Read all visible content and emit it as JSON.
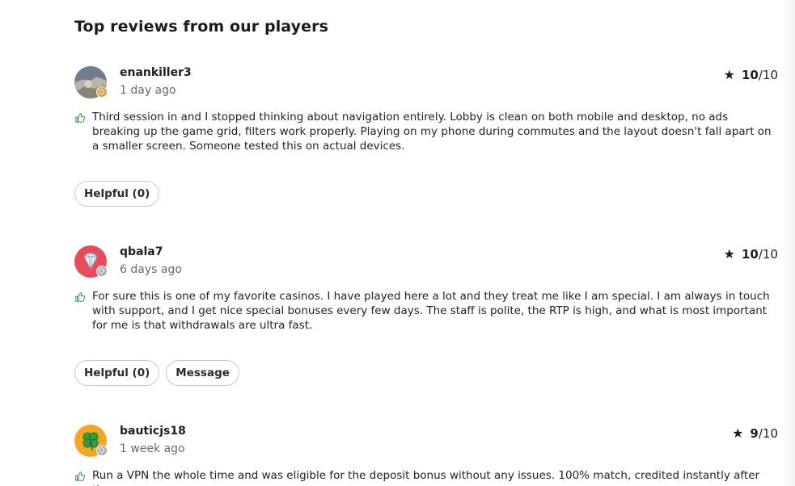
{
  "section": {
    "title": "Top reviews from our players"
  },
  "reviews": [
    {
      "username": "enankiller3",
      "time": "1 day ago",
      "score": "10",
      "max": "/10",
      "text": "Third session in and I stopped thinking about navigation entirely. Lobby is clean on both mobile and desktop, no ads breaking up the game grid, filters work properly. Playing on my phone during commutes and the layout doesn't fall apart on a smaller screen. Someone tested this on actual devices.",
      "helpful_label": "Helpful (0)",
      "avatar_icon": "photo-avatar",
      "badge_color": "#e59a3a"
    },
    {
      "username": "qbala7",
      "time": "6 days ago",
      "score": "10",
      "max": "/10",
      "text": "For sure this is one of my favorite casinos. I have played here a lot and they treat me like I am special. I am always in touch with support, and I get nice special bonuses every few days. The staff is polite, the RTP is high, and what is most important for me is that withdrawals are ultra fast.",
      "helpful_label": "Helpful (0)",
      "message_label": "Message",
      "avatar_icon": "diamond-icon",
      "avatar_color": "#e84c5b",
      "badge_color": "#a9afb6"
    },
    {
      "username": "bauticjs18",
      "time": "1 week ago",
      "score": "9",
      "max": "/10",
      "text": "Run a VPN the whole time and was eligible for the deposit bonus without any issues. 100% match, credited instantly after the",
      "avatar_icon": "clover-icon",
      "avatar_color": "#f5a623",
      "badge_color": "#a9afb6"
    }
  ],
  "icons": {
    "star": "★",
    "thumb": "thumbs-up-icon"
  }
}
